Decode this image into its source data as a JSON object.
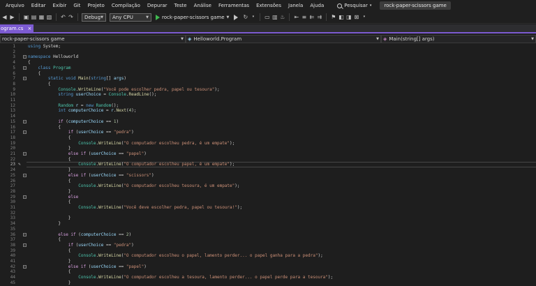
{
  "menu": [
    "Arquivo",
    "Editar",
    "Exibir",
    "Git",
    "Projeto",
    "Compilação",
    "Depurar",
    "Teste",
    "Análise",
    "Ferramentas",
    "Extensões",
    "Janela",
    "Ajuda"
  ],
  "search_label": "Pesquisar",
  "window_title": "rock-paper-scissors game",
  "toolbar": {
    "config": "Debug",
    "platform": "Any CPU",
    "run_target": "rock-paper-scissors game"
  },
  "tab": {
    "name": "ogram.cs",
    "close": "×"
  },
  "nav": {
    "project": "rock-paper-scissors game",
    "class": "Helloworld.Program",
    "member": "Main(string[] args)"
  },
  "editor": {
    "current_line": 23,
    "lines": [
      {
        "n": 1,
        "t": [
          [
            "kw",
            "using "
          ],
          [
            "",
            "System;"
          ]
        ]
      },
      {
        "n": 2,
        "t": []
      },
      {
        "n": 3,
        "t": [
          [
            "kw",
            "namespace "
          ],
          [
            "",
            "Helloworld"
          ]
        ]
      },
      {
        "n": 4,
        "t": [
          [
            "",
            "{"
          ]
        ]
      },
      {
        "n": 5,
        "t": [
          [
            "",
            "    "
          ],
          [
            "kw",
            "class "
          ],
          [
            "typ",
            "Program"
          ]
        ]
      },
      {
        "n": 6,
        "t": [
          [
            "",
            "    {"
          ]
        ]
      },
      {
        "n": 7,
        "t": [
          [
            "",
            "        "
          ],
          [
            "kw",
            "static void "
          ],
          [
            "fn",
            "Main"
          ],
          [
            "",
            "("
          ],
          [
            "kw",
            "string"
          ],
          [
            "",
            "[] "
          ],
          [
            "var",
            "args"
          ],
          [
            "",
            ")"
          ]
        ]
      },
      {
        "n": 8,
        "t": [
          [
            "",
            "        {"
          ]
        ]
      },
      {
        "n": 9,
        "t": [
          [
            "",
            "            "
          ],
          [
            "typ",
            "Console"
          ],
          [
            "",
            "."
          ],
          [
            "fn",
            "WriteLine"
          ],
          [
            "",
            "("
          ],
          [
            "str",
            "\"Você pode escolher pedra, papel ou tesoura\""
          ],
          [
            "",
            ");"
          ]
        ]
      },
      {
        "n": 10,
        "t": [
          [
            "",
            "            "
          ],
          [
            "kw",
            "string "
          ],
          [
            "var",
            "userChoice"
          ],
          [
            "",
            " = "
          ],
          [
            "typ",
            "Console"
          ],
          [
            "",
            "."
          ],
          [
            "fn",
            "ReadLine"
          ],
          [
            "",
            "();"
          ]
        ]
      },
      {
        "n": 11,
        "t": []
      },
      {
        "n": 12,
        "t": [
          [
            "",
            "            "
          ],
          [
            "typ",
            "Random "
          ],
          [
            "var",
            "r"
          ],
          [
            "",
            " = "
          ],
          [
            "kw",
            "new "
          ],
          [
            "typ",
            "Random"
          ],
          [
            "",
            "();"
          ]
        ]
      },
      {
        "n": 13,
        "t": [
          [
            "",
            "            "
          ],
          [
            "kw",
            "int "
          ],
          [
            "var",
            "computerChoice"
          ],
          [
            "",
            " = "
          ],
          [
            "var",
            "r"
          ],
          [
            "",
            "."
          ],
          [
            "fn",
            "Next"
          ],
          [
            "",
            "("
          ],
          [
            "num",
            "4"
          ],
          [
            "",
            ");"
          ]
        ]
      },
      {
        "n": 14,
        "t": []
      },
      {
        "n": 15,
        "t": [
          [
            "",
            "            "
          ],
          [
            "ctl",
            "if "
          ],
          [
            "",
            "("
          ],
          [
            "var",
            "computerChoice"
          ],
          [
            "",
            " == "
          ],
          [
            "num",
            "1"
          ],
          [
            "",
            ")"
          ]
        ]
      },
      {
        "n": 16,
        "t": [
          [
            "",
            "            {"
          ]
        ]
      },
      {
        "n": 17,
        "t": [
          [
            "",
            "                "
          ],
          [
            "ctl",
            "if "
          ],
          [
            "",
            "("
          ],
          [
            "var",
            "userChoice"
          ],
          [
            "",
            " == "
          ],
          [
            "str",
            "\"pedra\""
          ],
          [
            "",
            ")"
          ]
        ]
      },
      {
        "n": 18,
        "t": [
          [
            "",
            "                {"
          ]
        ]
      },
      {
        "n": 19,
        "t": [
          [
            "",
            "                    "
          ],
          [
            "typ",
            "Console"
          ],
          [
            "",
            "."
          ],
          [
            "fn",
            "WriteLine"
          ],
          [
            "",
            "("
          ],
          [
            "str",
            "\"O computador escolheu pedra, é um empate\""
          ],
          [
            "",
            ");"
          ]
        ]
      },
      {
        "n": 20,
        "t": [
          [
            "",
            "                }"
          ]
        ]
      },
      {
        "n": 21,
        "t": [
          [
            "",
            "                "
          ],
          [
            "ctl",
            "else if "
          ],
          [
            "",
            "("
          ],
          [
            "var",
            "userChoice"
          ],
          [
            "",
            " == "
          ],
          [
            "str",
            "\"papel\""
          ],
          [
            "",
            ")"
          ]
        ]
      },
      {
        "n": 22,
        "t": [
          [
            "",
            "                {"
          ]
        ]
      },
      {
        "n": 23,
        "t": [
          [
            "",
            "                    "
          ],
          [
            "typ",
            "Console"
          ],
          [
            "",
            "."
          ],
          [
            "fn",
            "WriteLine"
          ],
          [
            "",
            "("
          ],
          [
            "str",
            "\"O computador escolheu papel, é um empate\""
          ],
          [
            "",
            ");"
          ]
        ]
      },
      {
        "n": 24,
        "t": [
          [
            "",
            "                }"
          ]
        ]
      },
      {
        "n": 25,
        "t": [
          [
            "",
            "                "
          ],
          [
            "ctl",
            "else if "
          ],
          [
            "",
            "("
          ],
          [
            "var",
            "userChoice"
          ],
          [
            "",
            " == "
          ],
          [
            "str",
            "\"scissors\""
          ],
          [
            "",
            ")"
          ]
        ]
      },
      {
        "n": 26,
        "t": [
          [
            "",
            "                {"
          ]
        ]
      },
      {
        "n": 27,
        "t": [
          [
            "",
            "                    "
          ],
          [
            "typ",
            "Console"
          ],
          [
            "",
            "."
          ],
          [
            "fn",
            "WriteLine"
          ],
          [
            "",
            "("
          ],
          [
            "str",
            "\"O computador escolheu tesoura, é um empate\""
          ],
          [
            "",
            ");"
          ]
        ]
      },
      {
        "n": 28,
        "t": [
          [
            "",
            "                }"
          ]
        ]
      },
      {
        "n": 29,
        "t": [
          [
            "",
            "                "
          ],
          [
            "ctl",
            "else"
          ]
        ]
      },
      {
        "n": 30,
        "t": [
          [
            "",
            "                {"
          ]
        ]
      },
      {
        "n": 31,
        "t": [
          [
            "",
            "                    "
          ],
          [
            "typ",
            "Console"
          ],
          [
            "",
            "."
          ],
          [
            "fn",
            "WriteLine"
          ],
          [
            "",
            "("
          ],
          [
            "str",
            "\"Você deve escolher pedra, papel ou tesoura!\""
          ],
          [
            "",
            ");"
          ]
        ]
      },
      {
        "n": 32,
        "t": []
      },
      {
        "n": 33,
        "t": [
          [
            "",
            "                }"
          ]
        ]
      },
      {
        "n": 34,
        "t": [
          [
            "",
            "            }"
          ]
        ]
      },
      {
        "n": 35,
        "t": []
      },
      {
        "n": 36,
        "t": [
          [
            "",
            "            "
          ],
          [
            "ctl",
            "else if "
          ],
          [
            "",
            "("
          ],
          [
            "var",
            "computerChoice"
          ],
          [
            "",
            " == "
          ],
          [
            "num",
            "2"
          ],
          [
            "",
            ")"
          ]
        ]
      },
      {
        "n": 37,
        "t": [
          [
            "",
            "            {"
          ]
        ]
      },
      {
        "n": 38,
        "t": [
          [
            "",
            "                "
          ],
          [
            "ctl",
            "if "
          ],
          [
            "",
            "("
          ],
          [
            "var",
            "userChoice"
          ],
          [
            "",
            " == "
          ],
          [
            "str",
            "\"pedra\""
          ],
          [
            "",
            ")"
          ]
        ]
      },
      {
        "n": 39,
        "t": [
          [
            "",
            "                {"
          ]
        ]
      },
      {
        "n": 40,
        "t": [
          [
            "",
            "                    "
          ],
          [
            "typ",
            "Console"
          ],
          [
            "",
            "."
          ],
          [
            "fn",
            "WriteLine"
          ],
          [
            "",
            "("
          ],
          [
            "str",
            "\"O computador escolheu o papel, lamento perder... o papel ganha para a pedra\""
          ],
          [
            "",
            ");"
          ]
        ]
      },
      {
        "n": 41,
        "t": [
          [
            "",
            "                }"
          ]
        ]
      },
      {
        "n": 42,
        "t": [
          [
            "",
            "                "
          ],
          [
            "ctl",
            "else if "
          ],
          [
            "",
            "("
          ],
          [
            "var",
            "userChoice"
          ],
          [
            "",
            " == "
          ],
          [
            "str",
            "\"papel\""
          ],
          [
            "",
            ")"
          ]
        ]
      },
      {
        "n": 43,
        "t": [
          [
            "",
            "                {"
          ]
        ]
      },
      {
        "n": 44,
        "t": [
          [
            "",
            "                    "
          ],
          [
            "typ",
            "Console"
          ],
          [
            "",
            "."
          ],
          [
            "fn",
            "WriteLine"
          ],
          [
            "",
            "("
          ],
          [
            "str",
            "\"O computador escolheu a tesoura, lamento perder... o papel perde para a tesoura\""
          ],
          [
            "",
            ");"
          ]
        ]
      },
      {
        "n": 45,
        "t": [
          [
            "",
            "                }"
          ]
        ]
      }
    ]
  }
}
